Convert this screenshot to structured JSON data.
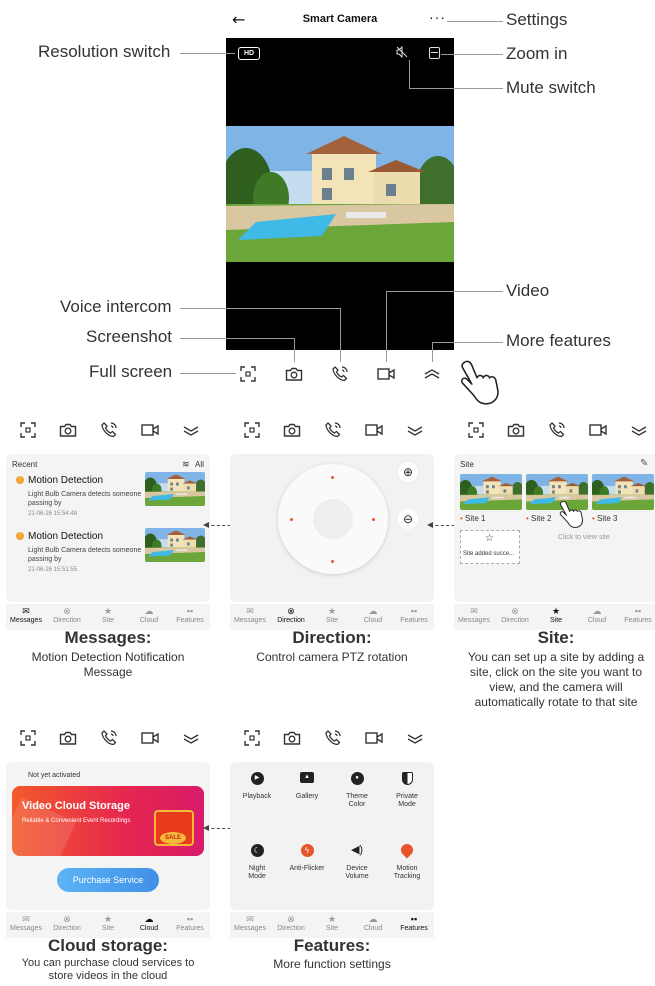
{
  "app": {
    "title": "Smart Camera",
    "back_icon": "back-arrow-icon",
    "more_icon": "more-dots-icon",
    "hd_label": "HD"
  },
  "callouts": {
    "resolution": "Resolution switch",
    "settings": "Settings",
    "zoom": "Zoom in",
    "mute": "Mute switch",
    "voice": "Voice intercom",
    "screenshot": "Screenshot",
    "fullscreen": "Full screen",
    "video": "Video",
    "more": "More features"
  },
  "nav": [
    "Messages",
    "Direction",
    "Site",
    "Cloud",
    "Features"
  ],
  "messages": {
    "recent": "Recent",
    "all": "All",
    "items": [
      {
        "title": "Motion Detection",
        "desc": "Light Bulb Camera detects someone passing by",
        "time": "21-06-26 15:54:48"
      },
      {
        "title": "Motion Detection",
        "desc": "Light Bulb Camera detects someone passing by",
        "time": "21-06-26 15:51:55"
      }
    ],
    "caption_title": "Messages:",
    "caption_text": "Motion Detection Notification Message"
  },
  "direction": {
    "caption_title": "Direction:",
    "caption_text": "Control camera PTZ rotation"
  },
  "site": {
    "header": "Site",
    "sites": [
      "Site 1",
      "Site 2",
      "Site 3"
    ],
    "added": "Site added succe...",
    "hint": "Click to view site",
    "caption_title": "Site:",
    "caption_text": "You can set up a site by adding a site, click on the site you want to view, and the camera will automatically rotate to that site"
  },
  "cloud": {
    "status": "Not yet activated",
    "banner_title": "Video Cloud Storage",
    "banner_sub": "Reliable & Convenient Event Recordings",
    "sale": "SALE",
    "button": "Purchase Service",
    "caption_title": "Cloud storage:",
    "caption_text": "You can purchase cloud services to store videos in the cloud"
  },
  "features": {
    "items": [
      {
        "label": "Playback",
        "icon": "play-icon"
      },
      {
        "label": "Gallery",
        "icon": "gallery-icon"
      },
      {
        "label": "Theme Color",
        "icon": "palette-icon"
      },
      {
        "label": "Private Mode",
        "icon": "privacy-icon"
      },
      {
        "label": "Night Mode",
        "icon": "moon-icon"
      },
      {
        "label": "Anti-Flicker",
        "icon": "flicker-icon"
      },
      {
        "label": "Device Volume",
        "icon": "volume-icon"
      },
      {
        "label": "Motion Tracking",
        "icon": "location-icon"
      }
    ],
    "caption_title": "Features:",
    "caption_text": "More function settings"
  }
}
